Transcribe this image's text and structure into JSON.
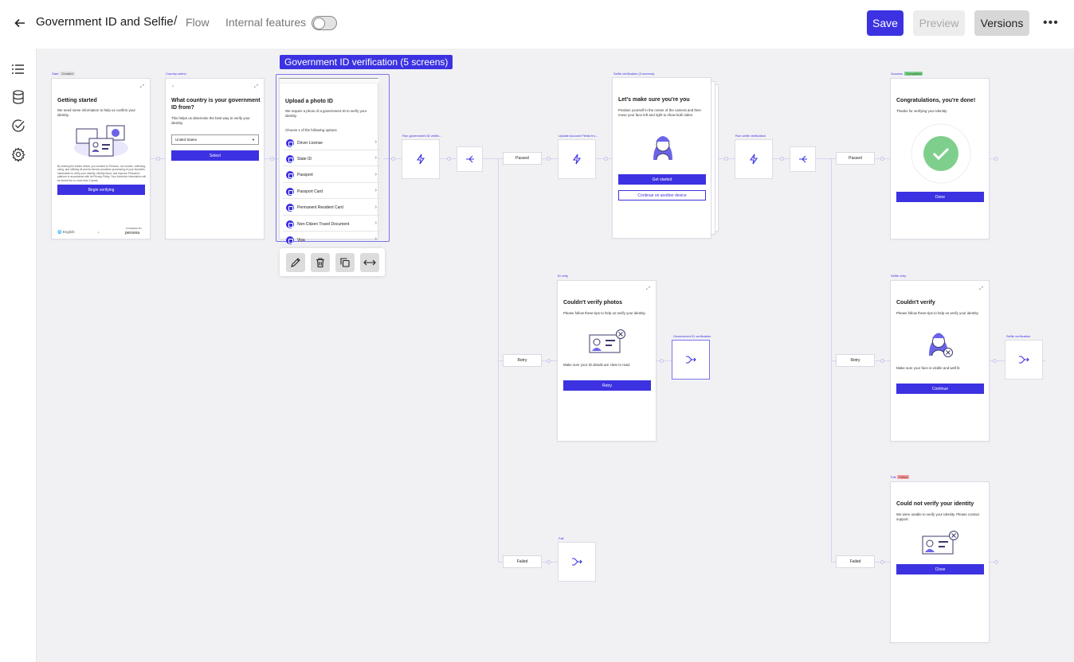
{
  "header": {
    "title": "Government ID and Selfie",
    "separator": "/",
    "section": "Flow",
    "internal_features_label": "Internal features",
    "internal_features_on": false,
    "save_label": "Save",
    "preview_label": "Preview",
    "versions_label": "Versions",
    "more_label": "•••"
  },
  "sidebar": {
    "items": [
      "list-icon",
      "database-icon",
      "check-circle-icon",
      "gear-icon"
    ]
  },
  "colors": {
    "accent": "#3c32e1",
    "success": "#7fcf8c",
    "fail_chip": "#f29c9c"
  },
  "group": {
    "label": "Government ID verification (5 screens)"
  },
  "screens": {
    "start": {
      "tag": "Start",
      "chip": "Created",
      "title": "Getting started",
      "body": "We need some information to help us confirm your identity.",
      "fine": "By clicking the button below, you consent to Persona, our vendor, collecting, using, and utilizing its and its service providers processing of your biometric information to verify your identity, identify fraud, and improve Persona's platform in accordance with its Privacy Policy. Your biometric information will be stored for no more than 3 years.",
      "button": "Begin verifying",
      "lang": "English",
      "powered": "POWERED BY",
      "brand": "persona"
    },
    "country": {
      "tag": "Country select",
      "title": "What country is your government ID from?",
      "body": "This helps us determine the best way to verify your identity.",
      "select_value": "United States",
      "button": "Select"
    },
    "upload": {
      "title": "Upload a photo ID",
      "body": "We require a photo of a government ID to verify your identity.",
      "choose": "Choose 1 of the following options",
      "options": [
        "Driver License",
        "State ID",
        "Passport",
        "Passport Card",
        "Permanent Resident Card",
        "Non-Citizen Travel Document",
        "Visa"
      ]
    },
    "selfie": {
      "tag": "Selfie verification (3 screens)",
      "title": "Let's make sure you're you",
      "body": "Position yourself in the center of the camera and then move your face left and right to show both sides.",
      "button": "Get started",
      "button2": "Continue on another device"
    },
    "success": {
      "tag": "Success",
      "chip": "Completed",
      "title": "Congratulations, you're done!",
      "body": "Thanks for verifying your identity.",
      "button": "Done"
    },
    "id_retry": {
      "tag": "ID retry",
      "title": "Couldn't verify photos",
      "body": "Please follow these tips to help us verify your identity.",
      "tip": "Make sure your ID details are clear to read.",
      "button": "Retry"
    },
    "selfie_retry": {
      "tag": "Selfie retry",
      "title": "Couldn't verify",
      "body": "Please follow these tips to help us verify your identity.",
      "tip": "Make sure your face is visible and well lit.",
      "button": "Continue"
    },
    "fail": {
      "tag": "Fail",
      "chip": "Failed",
      "title": "Could not verify your identity",
      "body": "We were unable to verify your identity. Please contact support.",
      "button": "Close"
    }
  },
  "nodes": {
    "run_gov": "Run government ID verific...",
    "update_fields": "Update Account Fields fro...",
    "run_selfie": "Run selfie verification",
    "gov_goto": "Government ID verification",
    "selfie_goto": "Selfie verification",
    "fail_goto": "Fail"
  },
  "branches": {
    "passed1": "Passed",
    "retry1": "Retry",
    "failed1": "Failed",
    "passed2": "Passed",
    "retry2": "Retry",
    "failed2": "Failed"
  }
}
